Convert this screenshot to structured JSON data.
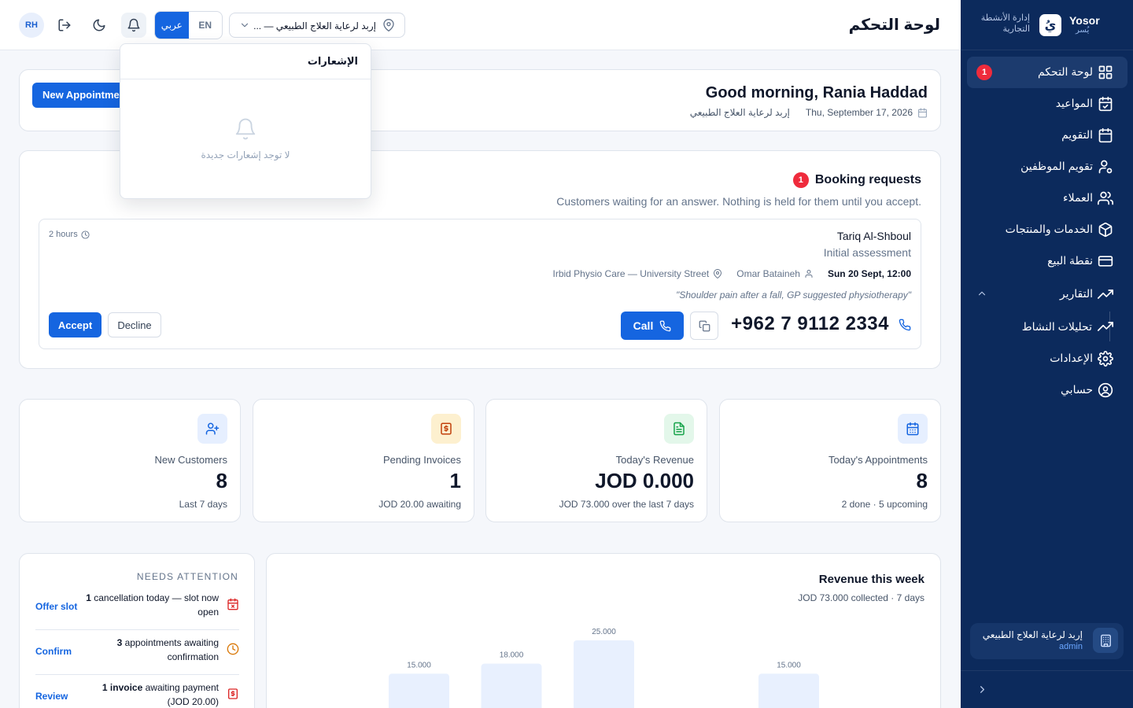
{
  "brand": {
    "name": "Yosor",
    "name_ar": "يُسر",
    "logo_letter": "يُ",
    "tagline": "إدارة الأنشطة التجارية"
  },
  "topbar": {
    "page_title": "لوحة التحكم",
    "avatar_initials": "RH",
    "lang_en": "EN",
    "lang_ar": "عربي",
    "location": "إربد لرعاية العلاج الطبيعي — ..."
  },
  "notifications": {
    "title": "الإشعارات",
    "empty": "لا توجد إشعارات جديدة"
  },
  "sidebar": {
    "items": [
      {
        "label": "لوحة التحكم",
        "badge": "1",
        "icon": "dashboard-icon"
      },
      {
        "label": "المواعيد",
        "icon": "calendar-check-icon"
      },
      {
        "label": "التقويم",
        "icon": "calendar-icon"
      },
      {
        "label": "تقويم الموظفين",
        "icon": "user-gear-icon"
      },
      {
        "label": "العملاء",
        "icon": "users-icon"
      },
      {
        "label": "الخدمات والمنتجات",
        "icon": "package-icon"
      },
      {
        "label": "نقطة البيع",
        "icon": "credit-card-icon"
      },
      {
        "label": "التقارير",
        "icon": "trending-up-icon"
      },
      {
        "label": "تحليلات النشاط",
        "icon": "trending-up-icon"
      },
      {
        "label": "الإعدادات",
        "icon": "gear-icon"
      },
      {
        "label": "حسابي",
        "icon": "user-circle-icon"
      }
    ],
    "org_name": "إربد لرعاية العلاج الطبيعي",
    "org_role": "admin"
  },
  "greeting": {
    "title": "Good morning, Rania Haddad",
    "date": "Thu, September 17, 2026",
    "org": "إربد لرعاية العلاج الطبيعي",
    "new_appointment": "New Appointment"
  },
  "booking": {
    "title": "Booking requests",
    "badge": "1",
    "subtitle": "Customers waiting for an answer. Nothing is held for them until you accept.",
    "request": {
      "customer": "Tariq Al-Shboul",
      "service": "Initial assessment",
      "ago": "2 hours",
      "datetime": "Sun 20 Sept, 12:00",
      "staff": "Omar Bataineh",
      "location": "Irbid Physio Care — University Street",
      "note": "\"Shoulder pain after a fall, GP suggested physiotherapy\"",
      "phone": "+962 7 9112 2334",
      "call": "Call",
      "accept": "Accept",
      "decline": "Decline"
    }
  },
  "stats": [
    {
      "label": "Today's Appointments",
      "value": "8",
      "sub": "2 done · 5 upcoming",
      "icon": "calendar-icon",
      "color": "#1565e0",
      "bg": "#e6efff"
    },
    {
      "label": "Today's Revenue",
      "value": "JOD 0.000",
      "sub": "JOD 73.000 over the last 7 days",
      "icon": "document-icon",
      "color": "#16a34a",
      "bg": "#e3f7ea"
    },
    {
      "label": "Pending Invoices",
      "value": "1",
      "sub": "JOD 20.00 awaiting",
      "icon": "invoice-icon",
      "color": "#c2410c",
      "bg": "#fdf0cf"
    },
    {
      "label": "New Customers",
      "value": "8",
      "sub": "Last 7 days",
      "icon": "user-plus-icon",
      "color": "#1565e0",
      "bg": "#e6efff"
    }
  ],
  "attention": {
    "title": "NEEDS ATTENTION",
    "items": [
      {
        "bold": "1",
        "text_before": "",
        "text_after": " cancellation today — slot now open",
        "action": "Offer slot",
        "icon": "calendar-x-icon",
        "color": "#dc2626"
      },
      {
        "bold": "3",
        "text_before": "",
        "text_after": " appointments awaiting confirmation",
        "action": "Confirm",
        "icon": "clock-icon",
        "color": "#d97706"
      },
      {
        "bold": "1 invoice",
        "text_before": "",
        "text_after": " awaiting payment (JOD 20.00)",
        "action": "Review",
        "icon": "invoice-x-icon",
        "color": "#dc2626"
      }
    ]
  },
  "revenue": {
    "title": "Revenue this week",
    "subtitle": "JOD 73.000 collected · 7 days"
  },
  "chart_data": {
    "type": "bar",
    "values": [
      15,
      18,
      25,
      0,
      15,
      0,
      0
    ],
    "value_labels": [
      "15.000",
      "18.000",
      "25.000",
      "",
      "15.000",
      "",
      ""
    ],
    "ylim": [
      0,
      25
    ],
    "bar_color": "#e8f0fe",
    "label_color": "#64748b"
  },
  "colors": {
    "primary": "#1565e0",
    "sidebar": "#0c2a5c",
    "badge": "#ef2b3c"
  }
}
